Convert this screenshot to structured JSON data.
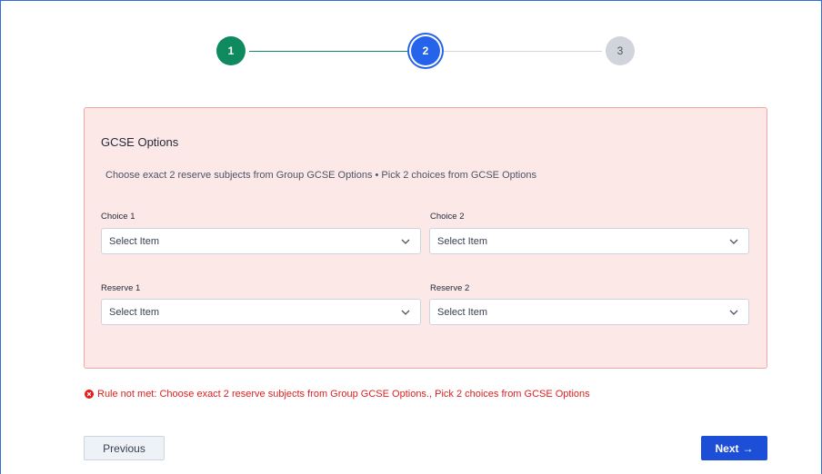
{
  "stepper": {
    "steps": [
      {
        "label": "1",
        "state": "completed"
      },
      {
        "label": "2",
        "state": "active"
      },
      {
        "label": "3",
        "state": "upcoming"
      }
    ]
  },
  "card": {
    "title": "GCSE Options",
    "description": "Choose exact 2 reserve subjects from Group GCSE Options • Pick 2 choices from GCSE Options",
    "fields": [
      {
        "label": "Choice 1",
        "value": "Select Item"
      },
      {
        "label": "Choice 2",
        "value": "Select Item"
      },
      {
        "label": "Reserve 1",
        "value": "Select Item"
      },
      {
        "label": "Reserve 2",
        "value": "Select Item"
      }
    ]
  },
  "error": {
    "icon": "error-circle-icon",
    "text": "Rule not met: Choose exact 2 reserve subjects from Group GCSE Options., Pick 2 choices from GCSE Options"
  },
  "buttons": {
    "previous_label": "Previous",
    "next_label": "Next",
    "next_icon": "→"
  },
  "colors": {
    "completed": "#0f8a5f",
    "active": "#2563eb",
    "upcoming": "#d1d5db",
    "error": "#e11d1d",
    "card_bg": "#fde8e8",
    "primary_button": "#1d4ed8"
  }
}
